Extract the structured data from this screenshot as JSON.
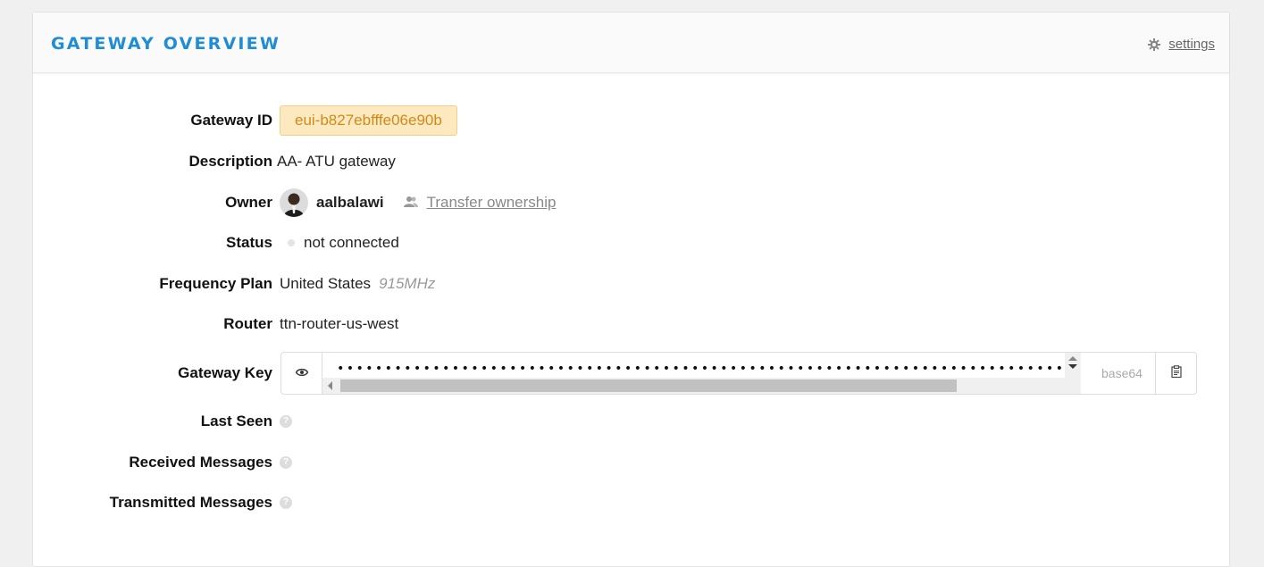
{
  "header": {
    "title": "GATEWAY OVERVIEW",
    "settings_label": "settings",
    "settings_icon": "gear-icon"
  },
  "fields": {
    "gateway_id": {
      "label": "Gateway ID",
      "value": "eui-b827ebfffe06e90b"
    },
    "description": {
      "label": "Description",
      "value": "AA- ATU gateway"
    },
    "owner": {
      "label": "Owner",
      "name": "aalbalawi",
      "transfer_label": "Transfer ownership"
    },
    "status": {
      "label": "Status",
      "value": "not connected"
    },
    "frequency_plan": {
      "label": "Frequency Plan",
      "value": "United States",
      "detail": "915MHz"
    },
    "router": {
      "label": "Router",
      "value": "ttn-router-us-west"
    },
    "gateway_key": {
      "label": "Gateway Key",
      "masked": "••••••••••••••••••••••••••••••••••••••••••••••••••••••••••••••••••••••••••••••••••••••••••••••",
      "format": "base64"
    },
    "last_seen": {
      "label": "Last Seen"
    },
    "received": {
      "label": "Received Messages"
    },
    "transmitted": {
      "label": "Transmitted Messages"
    }
  },
  "colors": {
    "accent": "#1f8dd6",
    "badge_bg": "#fde9c0",
    "badge_text": "#d08a1a"
  }
}
